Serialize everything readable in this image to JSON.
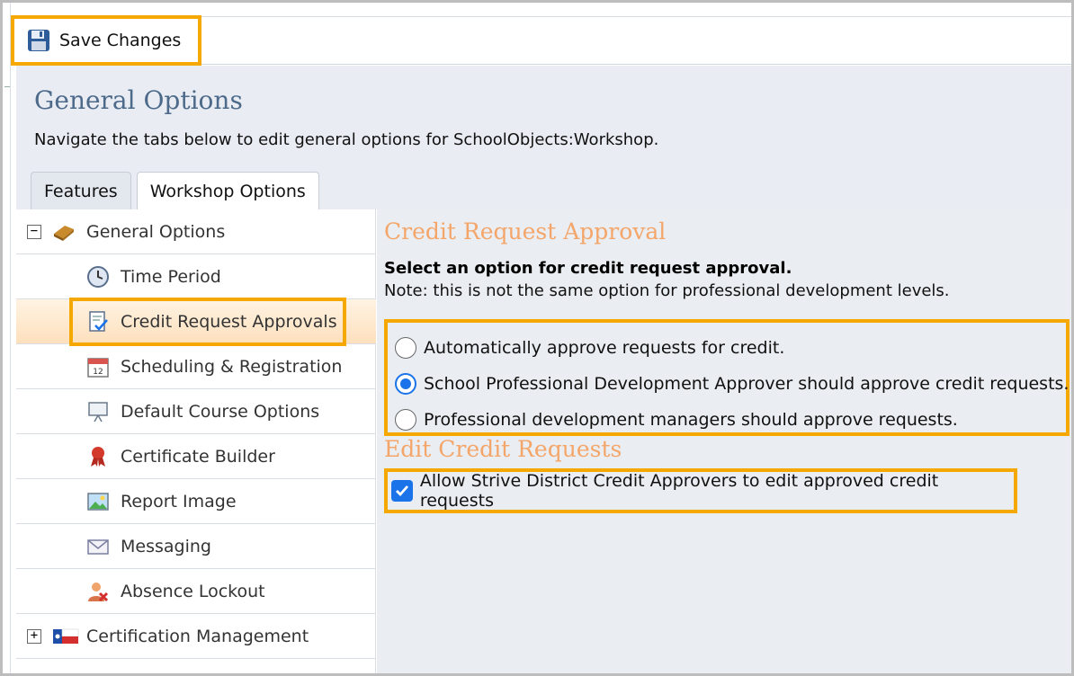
{
  "toolbar": {
    "save_label": "Save Changes"
  },
  "header": {
    "title": "General Options",
    "subtitle": "Navigate the tabs below to edit general options for SchoolObjects:Workshop.",
    "tabs": [
      {
        "label": "Features",
        "active": false
      },
      {
        "label": "Workshop Options",
        "active": true
      }
    ]
  },
  "tree": {
    "items": [
      {
        "label": "General Options",
        "icon": "book-icon",
        "level": 0,
        "expander": "−"
      },
      {
        "label": "Time Period",
        "icon": "clock-icon",
        "level": 1
      },
      {
        "label": "Credit Request Approvals",
        "icon": "document-check-icon",
        "level": 1,
        "selected": true
      },
      {
        "label": "Scheduling & Registration",
        "icon": "calendar-icon",
        "level": 1
      },
      {
        "label": "Default Course Options",
        "icon": "presentation-icon",
        "level": 1
      },
      {
        "label": "Certificate Builder",
        "icon": "ribbon-icon",
        "level": 1
      },
      {
        "label": "Report Image",
        "icon": "image-icon",
        "level": 1
      },
      {
        "label": "Messaging",
        "icon": "envelope-icon",
        "level": 1
      },
      {
        "label": "Absence Lockout",
        "icon": "user-x-icon",
        "level": 1
      },
      {
        "label": "Certification Management",
        "icon": "flag-icon",
        "level": 0,
        "expander": "+"
      }
    ]
  },
  "content": {
    "credit_title": "Credit Request Approval",
    "instruction": "Select an option for credit request approval.",
    "note": "Note: this is not the same option for professional development levels.",
    "options": [
      {
        "label": "Automatically approve requests for credit.",
        "selected": false
      },
      {
        "label": "School Professional Development Approver should approve credit requests.",
        "selected": true
      },
      {
        "label": "Professional development managers should approve requests.",
        "selected": false
      }
    ],
    "edit_title": "Edit Credit Requests",
    "edit_checkbox": {
      "label": "Allow Strive District Credit Approvers to edit approved credit requests",
      "checked": true
    }
  },
  "colors": {
    "highlight": "#f5a800",
    "section_title": "#f4a66a",
    "page_title": "#4d6a8a",
    "selection": "#1a73e8"
  }
}
